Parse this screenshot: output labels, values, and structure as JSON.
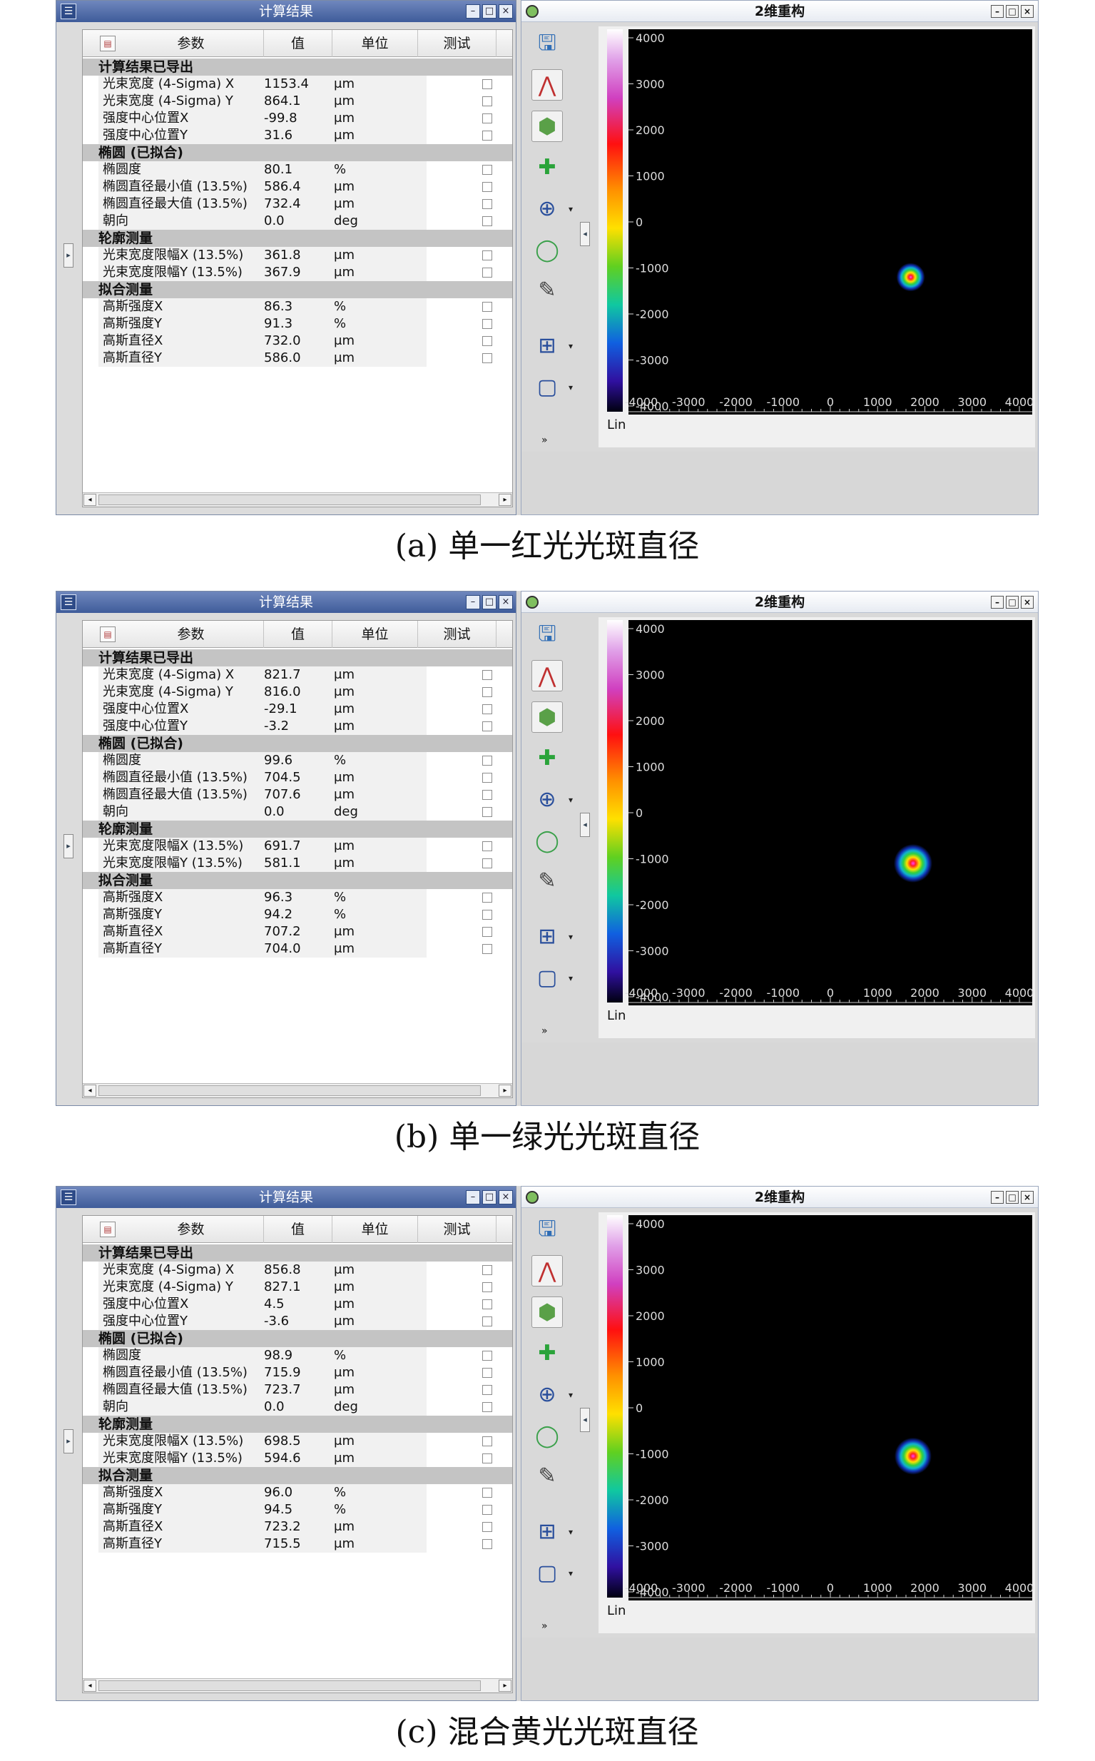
{
  "figures": [
    {
      "caption": "(a) 单一红光光斑直径",
      "left_title": "计算结果",
      "right_title": "2维重构",
      "headers": [
        "参数",
        "值",
        "单位",
        "测试"
      ],
      "sections": [
        {
          "title": "计算结果已导出",
          "rows": [
            [
              "光束宽度 (4-Sigma) X",
              "1153.4",
              "μm"
            ],
            [
              "光束宽度 (4-Sigma) Y",
              "864.1",
              "μm"
            ],
            [
              "强度中心位置X",
              "-99.8",
              "μm"
            ],
            [
              "强度中心位置Y",
              "31.6",
              "μm"
            ]
          ]
        },
        {
          "title": "椭圆 (已拟合)",
          "rows": [
            [
              "椭圆度",
              "80.1",
              "%"
            ],
            [
              "椭圆直径最小值 (13.5%)",
              "586.4",
              "μm"
            ],
            [
              "椭圆直径最大值 (13.5%)",
              "732.4",
              "μm"
            ],
            [
              "朝向",
              "0.0",
              "deg"
            ]
          ]
        },
        {
          "title": "轮廓测量",
          "rows": [
            [
              "光束宽度限幅X (13.5%)",
              "361.8",
              "μm"
            ],
            [
              "光束宽度限幅Y (13.5%)",
              "367.9",
              "μm"
            ]
          ]
        },
        {
          "title": "拟合测量",
          "rows": [
            [
              "高斯强度X",
              "86.3",
              "%"
            ],
            [
              "高斯强度Y",
              "91.3",
              "%"
            ],
            [
              "高斯直径X",
              "732.0",
              "μm"
            ],
            [
              "高斯直径Y",
              "586.0",
              "μm"
            ]
          ]
        }
      ],
      "plot": {
        "scale_label": "Lin",
        "y_ticks": [
          4000,
          3000,
          2000,
          1000,
          0,
          -1000,
          -2000,
          -3000,
          -4000
        ],
        "x_ticks": [
          -4000,
          -3000,
          -2000,
          -1000,
          0,
          1000,
          2000,
          3000,
          4000
        ],
        "spot": {
          "x": 1700,
          "y": -1200,
          "size": 1
        }
      }
    },
    {
      "caption": "(b) 单一绿光光斑直径",
      "left_title": "计算结果",
      "right_title": "2维重构",
      "headers": [
        "参数",
        "值",
        "单位",
        "测试"
      ],
      "sections": [
        {
          "title": "计算结果已导出",
          "rows": [
            [
              "光束宽度 (4-Sigma) X",
              "821.7",
              "μm"
            ],
            [
              "光束宽度 (4-Sigma) Y",
              "816.0",
              "μm"
            ],
            [
              "强度中心位置X",
              "-29.1",
              "μm"
            ],
            [
              "强度中心位置Y",
              "-3.2",
              "μm"
            ]
          ]
        },
        {
          "title": "椭圆 (已拟合)",
          "rows": [
            [
              "椭圆度",
              "99.6",
              "%"
            ],
            [
              "椭圆直径最小值 (13.5%)",
              "704.5",
              "μm"
            ],
            [
              "椭圆直径最大值 (13.5%)",
              "707.6",
              "μm"
            ],
            [
              "朝向",
              "0.0",
              "deg"
            ]
          ]
        },
        {
          "title": "轮廓测量",
          "rows": [
            [
              "光束宽度限幅X (13.5%)",
              "691.7",
              "μm"
            ],
            [
              "光束宽度限幅Y (13.5%)",
              "581.1",
              "μm"
            ]
          ]
        },
        {
          "title": "拟合测量",
          "rows": [
            [
              "高斯强度X",
              "96.3",
              "%"
            ],
            [
              "高斯强度Y",
              "94.2",
              "%"
            ],
            [
              "高斯直径X",
              "707.2",
              "μm"
            ],
            [
              "高斯直径Y",
              "704.0",
              "μm"
            ]
          ]
        }
      ],
      "plot": {
        "scale_label": "Lin",
        "y_ticks": [
          4000,
          3000,
          2000,
          1000,
          0,
          -1000,
          -2000,
          -3000,
          -4000
        ],
        "x_ticks": [
          -4000,
          -3000,
          -2000,
          -1000,
          0,
          1000,
          2000,
          3000,
          4000
        ],
        "spot": {
          "x": 1750,
          "y": -1100,
          "size": 1.35
        }
      }
    },
    {
      "caption": "(c) 混合黄光光斑直径",
      "left_title": "计算结果",
      "right_title": "2维重构",
      "headers": [
        "参数",
        "值",
        "单位",
        "测试"
      ],
      "sections": [
        {
          "title": "计算结果已导出",
          "rows": [
            [
              "光束宽度 (4-Sigma) X",
              "856.8",
              "μm"
            ],
            [
              "光束宽度 (4-Sigma) Y",
              "827.1",
              "μm"
            ],
            [
              "强度中心位置X",
              "4.5",
              "μm"
            ],
            [
              "强度中心位置Y",
              "-3.6",
              "μm"
            ]
          ]
        },
        {
          "title": "椭圆 (已拟合)",
          "rows": [
            [
              "椭圆度",
              "98.9",
              "%"
            ],
            [
              "椭圆直径最小值 (13.5%)",
              "715.9",
              "μm"
            ],
            [
              "椭圆直径最大值 (13.5%)",
              "723.7",
              "μm"
            ],
            [
              "朝向",
              "0.0",
              "deg"
            ]
          ]
        },
        {
          "title": "轮廓测量",
          "rows": [
            [
              "光束宽度限幅X (13.5%)",
              "698.5",
              "μm"
            ],
            [
              "光束宽度限幅Y (13.5%)",
              "594.6",
              "μm"
            ]
          ]
        },
        {
          "title": "拟合测量",
          "rows": [
            [
              "高斯强度X",
              "96.0",
              "%"
            ],
            [
              "高斯强度Y",
              "94.5",
              "%"
            ],
            [
              "高斯直径X",
              "723.2",
              "μm"
            ],
            [
              "高斯直径Y",
              "715.5",
              "μm"
            ]
          ]
        }
      ],
      "plot": {
        "scale_label": "Lin",
        "y_ticks": [
          4000,
          3000,
          2000,
          1000,
          0,
          -1000,
          -2000,
          -3000,
          -4000
        ],
        "x_ticks": [
          -4000,
          -3000,
          -2000,
          -1000,
          0,
          1000,
          2000,
          3000,
          4000
        ],
        "spot": {
          "x": 1750,
          "y": -1050,
          "size": 1.3
        }
      }
    }
  ],
  "toolbar_icons": [
    "save-image-icon",
    "profile-icon",
    "3d-view-icon",
    "add-icon",
    "crosshair-icon",
    "ellipse-icon",
    "annotate-icon",
    "grid-icon",
    "rectangle-icon"
  ],
  "colors": {
    "title_blue": "#4a66a6",
    "section_gray": "#c4c4c4",
    "plot_bg": "#000000"
  }
}
